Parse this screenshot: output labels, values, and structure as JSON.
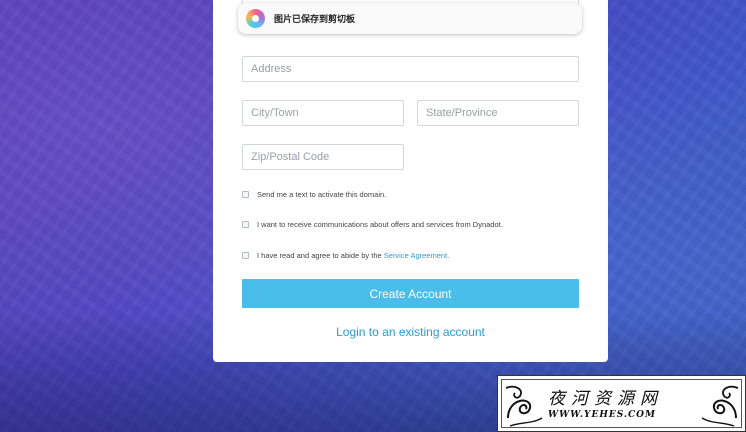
{
  "toast": {
    "text": "图片已保存到剪切板",
    "icon": "photo-app-icon"
  },
  "form": {
    "address_placeholder": "Address",
    "city_placeholder": "City/Town",
    "state_placeholder": "State/Province",
    "zip_placeholder": "Zip/Postal Code",
    "checkboxes": [
      {
        "label": "Send me a text to activate this domain.",
        "checked": false
      },
      {
        "label": "I want to receive communications about offers and services from Dynadot.",
        "checked": false
      },
      {
        "label_prefix": "I have read and agree to abide by the ",
        "link": "Service Agreement",
        "label_suffix": ".",
        "checked": false
      }
    ],
    "create_button": "Create Account",
    "login_link": "Login to an existing account"
  },
  "watermark": {
    "title": "夜河资源网",
    "url": "WWW.YEHES.COM"
  },
  "colors": {
    "accent": "#4bbdea",
    "link": "#2b9bd6",
    "background": "#4a46c4"
  }
}
